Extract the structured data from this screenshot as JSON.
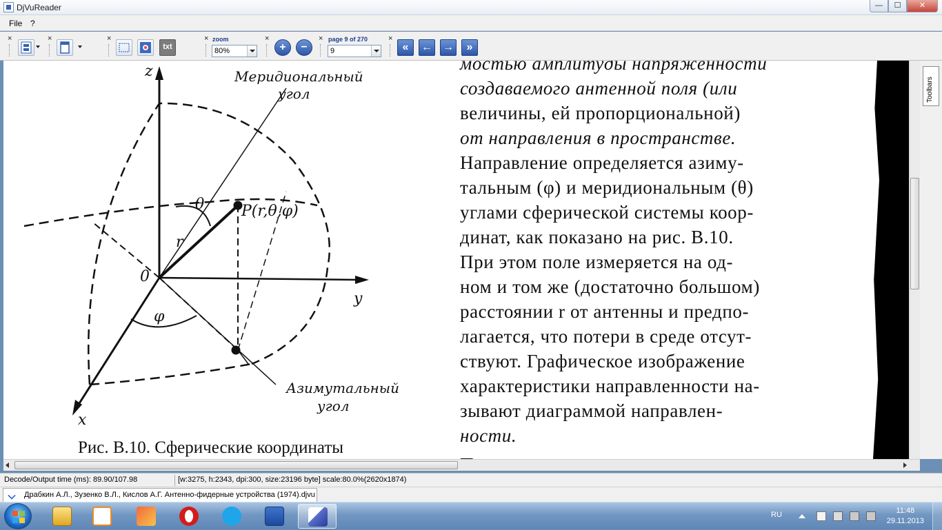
{
  "window": {
    "title": "DjVuReader",
    "min": "—",
    "max": "☐",
    "close": "✕"
  },
  "menu": {
    "file": "File",
    "help": "?"
  },
  "toolbar": {
    "zoom_label": "zoom",
    "zoom_value": "80%",
    "page_label": "page 9 of 270",
    "page_value": "9",
    "text_btn": "txt",
    "zoom_in": "+",
    "zoom_out": "−",
    "first": "«",
    "prev": "←",
    "next": "→",
    "last": "»"
  },
  "sidebar": {
    "toolbars_tab": "Toolbars"
  },
  "figure": {
    "meridional": "Меридиональный",
    "meridional2": "угол",
    "azimuthal": "Азимутальный",
    "azimuthal2": "угол",
    "z": "z",
    "y": "y",
    "x": "x",
    "o": "0",
    "r": "r",
    "theta": "θ",
    "phi": "φ",
    "point": "P(r,θ,φ)"
  },
  "caption": "Рис.   В.10. Сферические    координаты",
  "text_lines": [
    "мостью амплитуды напряженности",
    "создаваемого  антенной  поля  (или",
    "величины,  ей  пропорциональной)",
    "от  направления  в  пространстве.",
    "Направление определяется  азиму-",
    "тальным (φ)  и меридиональным (θ)",
    "углами сферической системы коор-",
    "динат, как показано на рис. В.10.",
    "При этом поле  измеряется  на  од-",
    "ном и том же (достаточно большом)",
    "расстоянии r от антенны  и  предпо-",
    "лагается, что потери в среде  отсут-",
    "ствуют. Графическое  изображение",
    "характеристики направленности на-",
    "зывают    диаграммой    направлен-",
    "ности.",
    "     Пространственная диаграмма на-"
  ],
  "status": {
    "decode": "Decode/Output time (ms): 89.90/107.98",
    "info": "[w:3275, h:2343, dpi:300, size:23196 byte] scale:80.0%(2620x1874)"
  },
  "document_tab": "Драбкин А.Л., Зузенко В.Л., Кислов А.Г. Антенно-фидерные устройства (1974).djvu",
  "taskbar": {
    "lang": "RU",
    "time": "11:48",
    "date": "29.11.2013",
    "apps": [
      "explorer-icon",
      "media-player-icon",
      "paint-icon",
      "opera-icon",
      "skype-icon",
      "word-icon",
      "djvu-reader-icon"
    ]
  },
  "colors": {
    "accent": "#1c3b8c",
    "taskbar": "#6b8fb5"
  }
}
